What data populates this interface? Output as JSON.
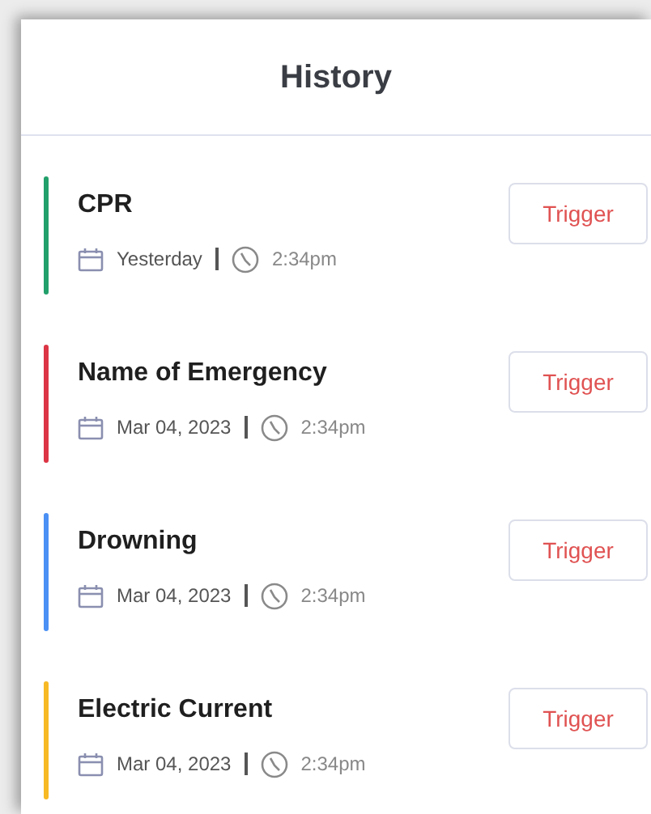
{
  "header": {
    "title": "History"
  },
  "items": [
    {
      "name": "CPR",
      "color": "#22a06b",
      "date": "Yesterday",
      "time": "2:34pm",
      "button": "Trigger"
    },
    {
      "name": "Name of Emergency",
      "color": "#dc3545",
      "date": "Mar 04, 2023",
      "time": "2:34pm",
      "button": "Trigger"
    },
    {
      "name": "Drowning",
      "color": "#4a90f5",
      "date": "Mar 04, 2023",
      "time": "2:34pm",
      "button": "Trigger"
    },
    {
      "name": "Electric Current",
      "color": "#f7b924",
      "date": "Mar 04, 2023",
      "time": "2:34pm",
      "button": "Trigger"
    }
  ]
}
